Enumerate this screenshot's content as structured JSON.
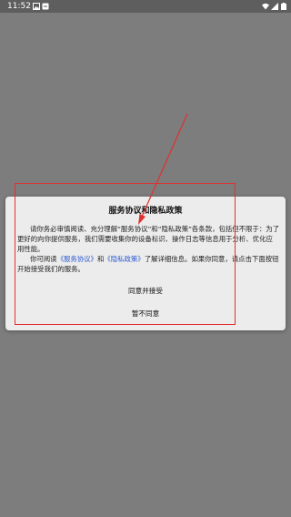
{
  "status_bar": {
    "time": "11:52",
    "icons": [
      "image-icon",
      "notification-icon",
      "wifi-icon",
      "signal-icon",
      "battery-icon"
    ]
  },
  "dialog": {
    "title": "服务协议和隐私政策",
    "paragraph1": "请你务必审慎阅读、充分理解“服务协议”和“隐私政策”各条款，包括但不限于：为了更好的向你提供服务，我们需要收集你的设备标识、操作日志等信息用于分析、优化应用性能。",
    "paragraph2_prefix": "你可阅读",
    "service_link": "《服务协议》",
    "paragraph2_and": "和",
    "privacy_link": "《隐私政策》",
    "paragraph2_suffix": "了解详细信息。如果你同意，请点击下面按钮开始接受我们的服务。",
    "agree_label": "同意并接受",
    "disagree_label": "暂不同意"
  },
  "colors": {
    "overlay_background": "#7d7d7d",
    "dialog_background": "#ececec",
    "link": "#2f5ad0",
    "annotation": "#e03030"
  }
}
